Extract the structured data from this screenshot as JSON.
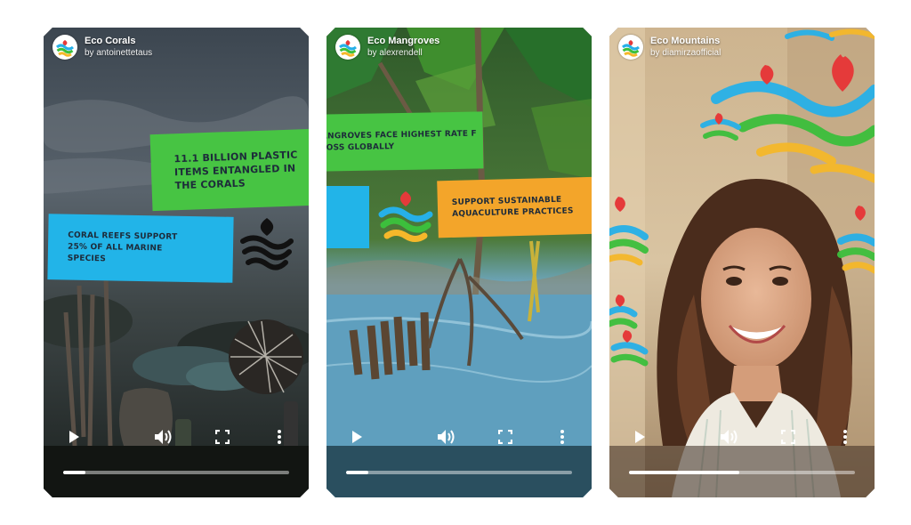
{
  "videos": [
    {
      "title": "Eco Corals",
      "author": "by antoinettetaus",
      "banners": {
        "green": "11.1 BILLION PLASTIC ITEMS ENTANGLED IN THE CORALS",
        "blue": "CORAL REEFS SUPPORT 25% OF ALL MARINE SPECIES"
      },
      "progress": 0.1,
      "controls": [
        "play-icon",
        "volume-icon",
        "fullscreen-icon",
        "more-vertical-icon"
      ]
    },
    {
      "title": "Eco Mangroves",
      "author": "by alexrendell",
      "banners": {
        "green": "ANGROVES FACE HIGHEST RATE F LOSS GLOBALLY",
        "orange": "SUPPORT SUSTAINABLE AQUACULTURE PRACTICES"
      },
      "progress": 0.1,
      "controls": [
        "play-icon",
        "volume-icon",
        "fullscreen-icon",
        "more-vertical-icon"
      ]
    },
    {
      "title": "Eco Mountains",
      "author": "by diamirzaofficial",
      "progress": 0.49,
      "controls": [
        "play-icon",
        "volume-icon",
        "fullscreen-icon",
        "more-vertical-icon"
      ]
    }
  ],
  "colors": {
    "banner_green": "#47c443",
    "banner_blue": "#22b4e8",
    "banner_orange": "#f3a52a",
    "progress_track": "#bfbfbf",
    "progress_fill": "#ffffff"
  }
}
